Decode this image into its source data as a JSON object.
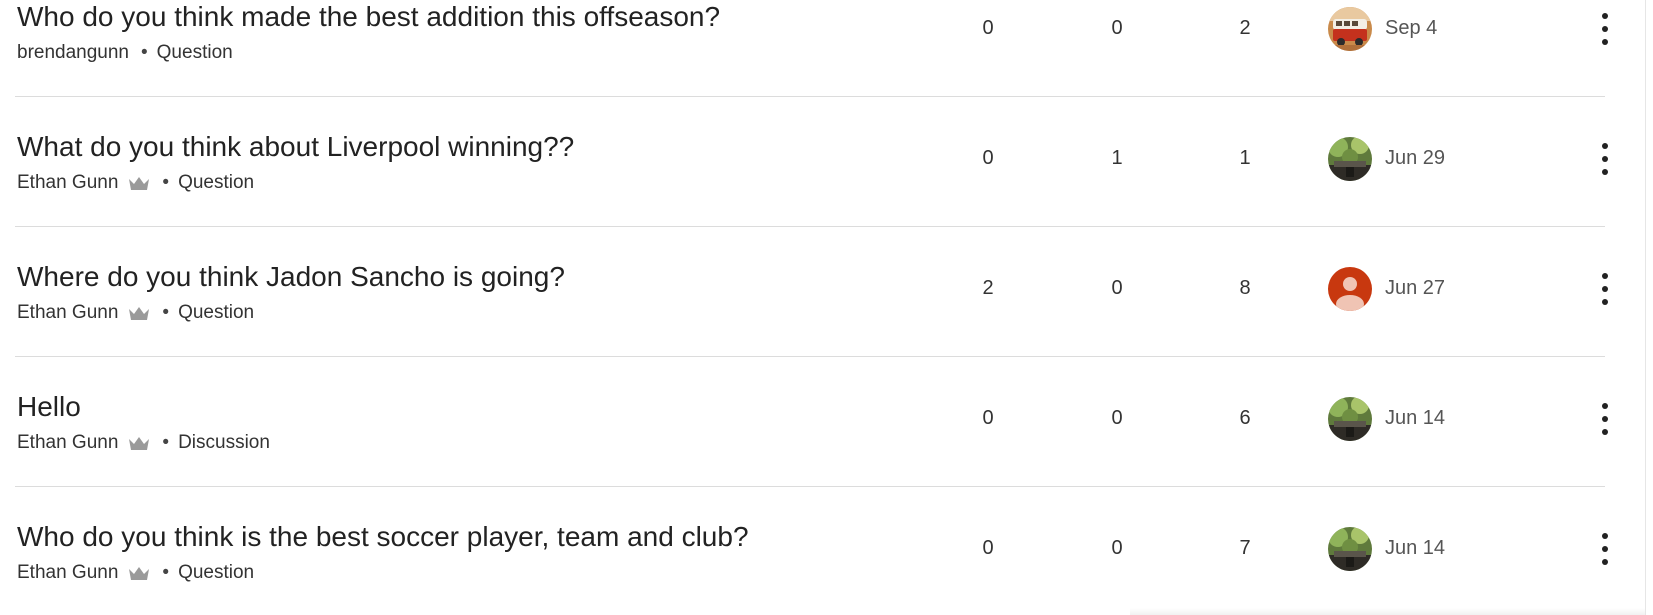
{
  "posts": [
    {
      "title": "Who do you think made the best addition this offseason?",
      "author": "brendangunn",
      "admin": false,
      "kind": "Question",
      "stat1": "0",
      "stat2": "0",
      "stat3": "2",
      "avatar": "van-photo-avatar",
      "date": "Sep 4"
    },
    {
      "title": "What do you think about Liverpool winning??",
      "author": "Ethan Gunn",
      "admin": true,
      "kind": "Question",
      "stat1": "0",
      "stat2": "1",
      "stat3": "1",
      "avatar": "garden-photo-avatar",
      "date": "Jun 29"
    },
    {
      "title": "Where do you think Jadon Sancho is going?",
      "author": "Ethan Gunn",
      "admin": true,
      "kind": "Question",
      "stat1": "2",
      "stat2": "0",
      "stat3": "8",
      "avatar": "default-person-avatar",
      "date": "Jun 27"
    },
    {
      "title": "Hello",
      "author": "Ethan Gunn",
      "admin": true,
      "kind": "Discussion",
      "stat1": "0",
      "stat2": "0",
      "stat3": "6",
      "avatar": "garden-photo-avatar",
      "date": "Jun 14"
    },
    {
      "title": "Who do you think is the best soccer player, team and club?",
      "author": "Ethan Gunn",
      "admin": true,
      "kind": "Question",
      "stat1": "0",
      "stat2": "0",
      "stat3": "7",
      "avatar": "garden-photo-avatar",
      "date": "Jun 14"
    }
  ],
  "separator": "•",
  "colors": {
    "default_avatar": "#c8380f",
    "text": "#222222",
    "divider": "#dcdcdc"
  }
}
